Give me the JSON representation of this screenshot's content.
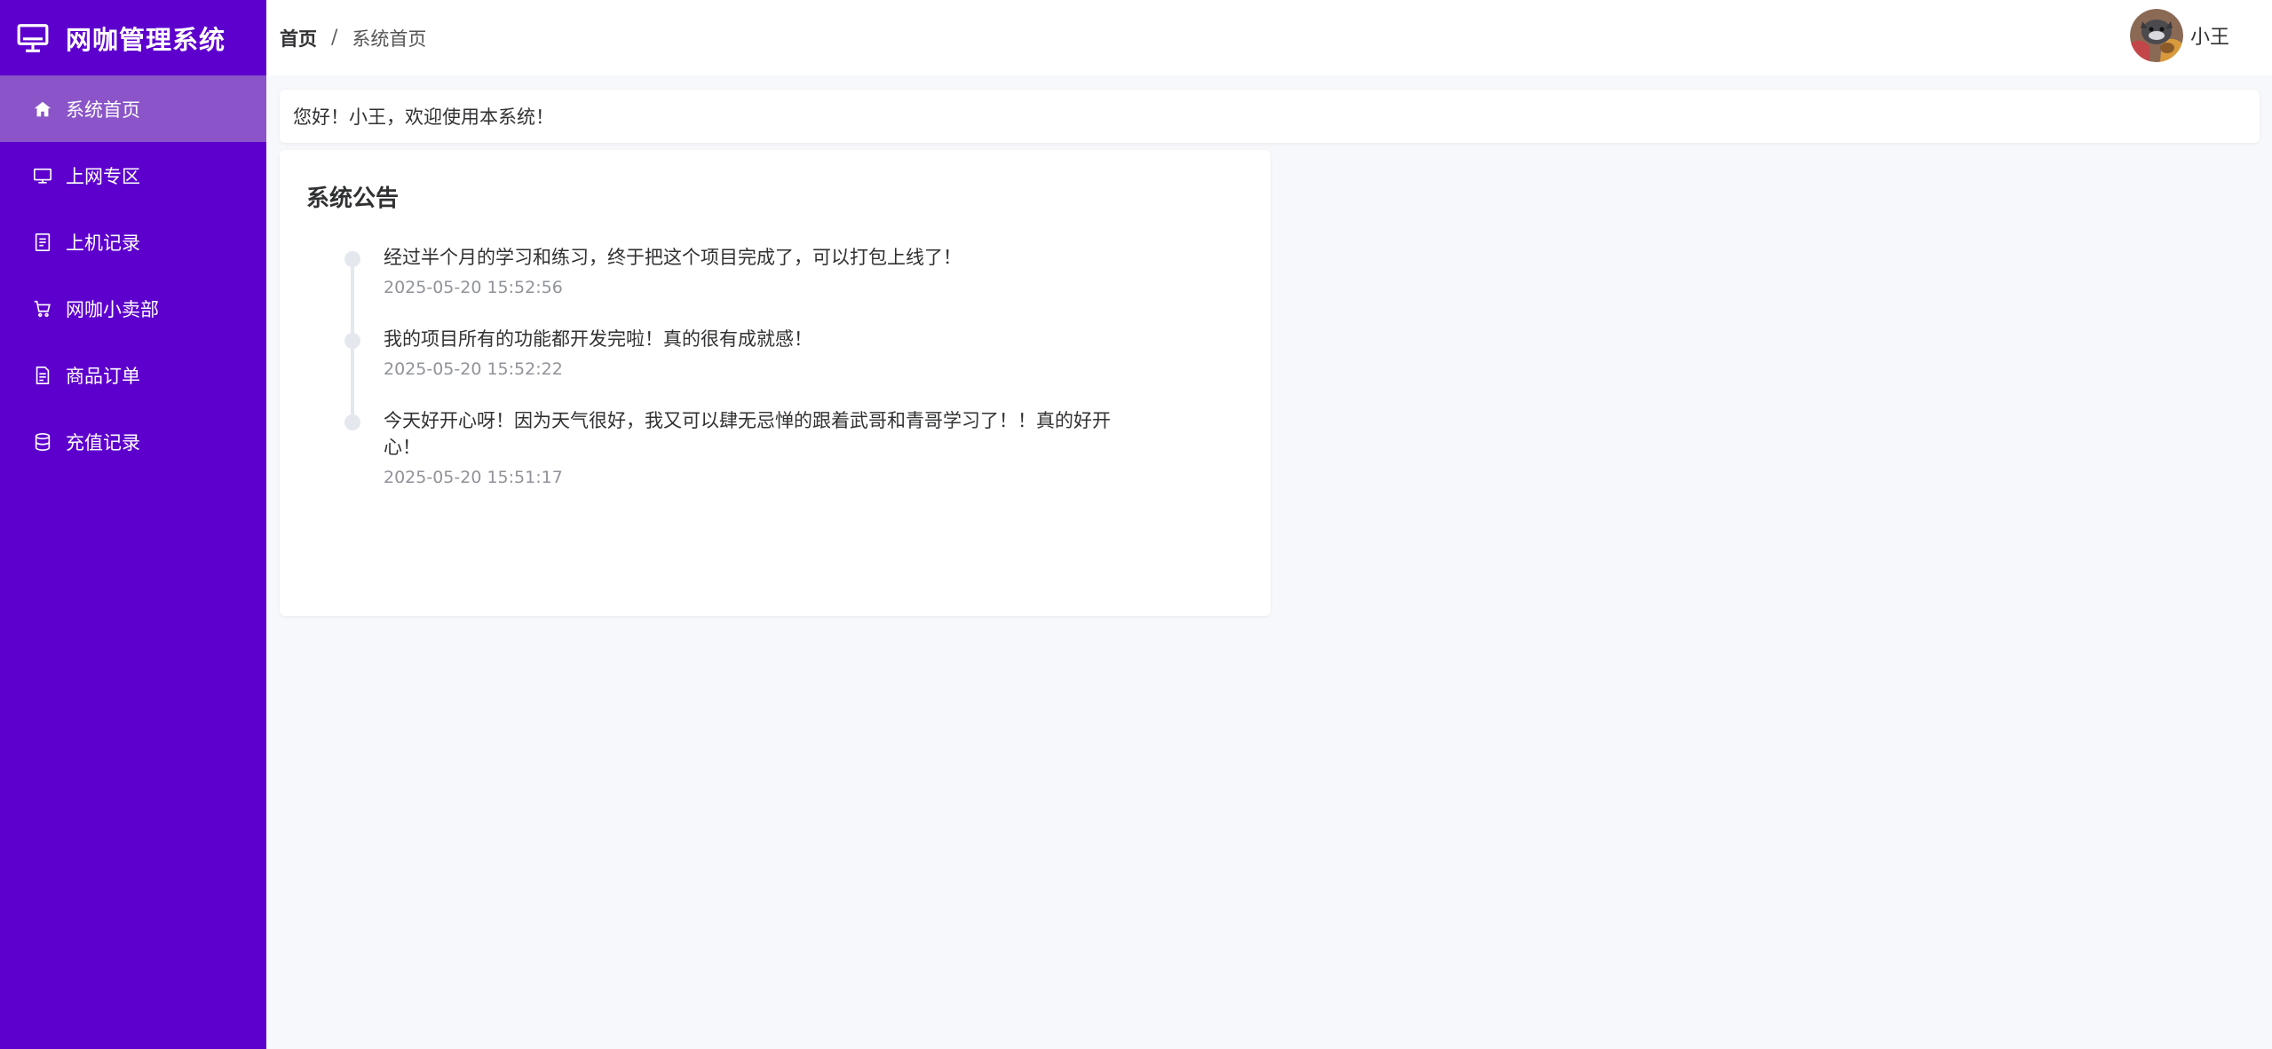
{
  "app": {
    "title": "网咖管理系统"
  },
  "sidebar": {
    "items": [
      {
        "label": "系统首页",
        "icon": "home-icon",
        "active": true
      },
      {
        "label": "上网专区",
        "icon": "monitor-icon"
      },
      {
        "label": "上机记录",
        "icon": "document-list-icon"
      },
      {
        "label": "网咖小卖部",
        "icon": "cart-icon"
      },
      {
        "label": "商品订单",
        "icon": "order-icon"
      },
      {
        "label": "充值记录",
        "icon": "database-icon"
      }
    ]
  },
  "header": {
    "breadcrumb": {
      "home": "首页",
      "separator": "/",
      "current": "系统首页"
    },
    "user": {
      "name": "小王"
    }
  },
  "welcome": {
    "text": "您好！小王，欢迎使用本系统！"
  },
  "notice": {
    "title": "系统公告",
    "items": [
      {
        "content": "经过半个月的学习和练习，终于把这个项目完成了，可以打包上线了！",
        "time": "2025-05-20 15:52:56"
      },
      {
        "content": "我的项目所有的功能都开发完啦！真的很有成就感！",
        "time": "2025-05-20 15:52:22"
      },
      {
        "content": "今天好开心呀！因为天气很好，我又可以肆无忌惮的跟着武哥和青哥学习了！！真的好开心！",
        "time": "2025-05-20 15:51:17"
      }
    ]
  },
  "colors": {
    "sidebar_bg": "#5e00cd",
    "sidebar_active": "#8b55c9",
    "page_bg": "#f7f8fc"
  }
}
